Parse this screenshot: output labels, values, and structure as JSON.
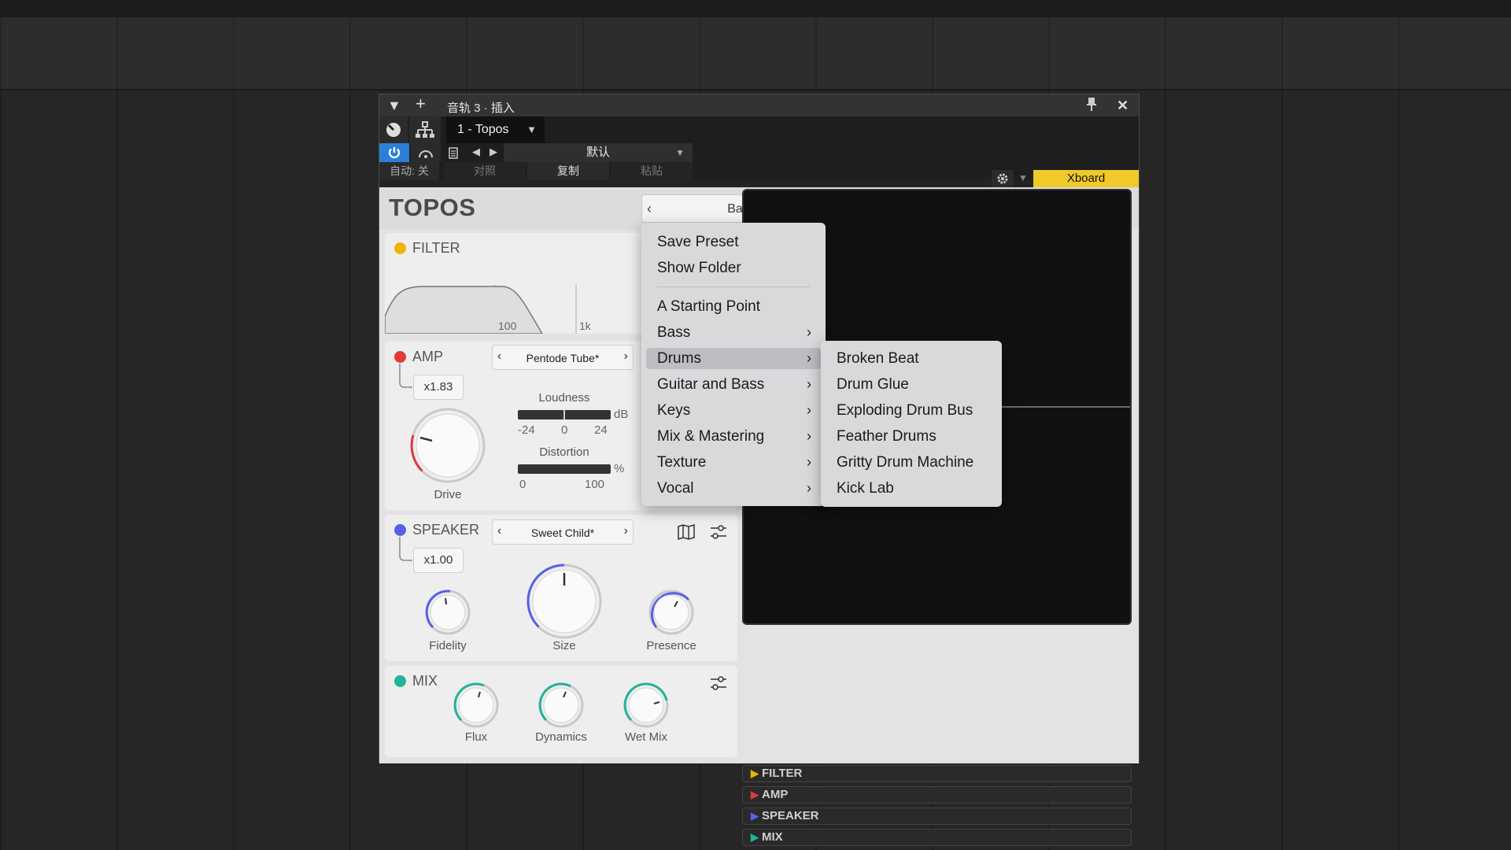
{
  "window": {
    "title": "音轨 3 · 插入",
    "plugin_tab": "1 - Topos",
    "preset_default": "默认",
    "auto_label": "自动: 关",
    "compare_label": "对照",
    "copy_label": "复制",
    "paste_label": "粘贴",
    "xboard_label": "Xboard"
  },
  "plugin": {
    "brand": "TOPOS",
    "preset_name": "Bass Vader",
    "filter": {
      "label": "FILTER",
      "ticks": [
        "100",
        "1k"
      ],
      "color": "#f0b400"
    },
    "amp": {
      "label": "AMP",
      "color": "#e03a3a",
      "multiplier": "x1.83",
      "model": "Pentode Tube*",
      "loudness_label": "Loudness",
      "loudness_unit": "dB",
      "loudness_ticks": [
        "-24",
        "0",
        "24"
      ],
      "distortion_label": "Distortion",
      "distortion_unit": "%",
      "distortion_ticks": [
        "0",
        "100"
      ],
      "drive_label": "Drive"
    },
    "speaker": {
      "label": "SPEAKER",
      "color": "#5561e8",
      "multiplier": "x1.00",
      "model": "Sweet Child*",
      "knobs": [
        "Fidelity",
        "Size",
        "Presence"
      ]
    },
    "mix": {
      "label": "MIX",
      "color": "#22b39a",
      "knobs": [
        "Flux",
        "Dynamics",
        "Wet Mix"
      ]
    },
    "sections": [
      {
        "label": "FILTER",
        "color": "#f0b400"
      },
      {
        "label": "AMP",
        "color": "#e03a3a"
      },
      {
        "label": "SPEAKER",
        "color": "#5561e8"
      },
      {
        "label": "MIX",
        "color": "#22b39a"
      }
    ]
  },
  "menu": {
    "items_top": [
      "Save Preset",
      "Show Folder"
    ],
    "items": [
      {
        "label": "A Starting Point",
        "submenu": false
      },
      {
        "label": "Bass",
        "submenu": true
      },
      {
        "label": "Drums",
        "submenu": true
      },
      {
        "label": "Guitar and Bass",
        "submenu": true
      },
      {
        "label": "Keys",
        "submenu": true
      },
      {
        "label": "Mix & Mastering",
        "submenu": true
      },
      {
        "label": "Texture",
        "submenu": true
      },
      {
        "label": "Vocal",
        "submenu": true
      }
    ],
    "highlighted": "Drums"
  },
  "submenu": {
    "items": [
      "Broken Beat",
      "Drum Glue",
      "Exploding Drum Bus",
      "Feather Drums",
      "Gritty Drum Machine",
      "Kick Lab"
    ]
  }
}
